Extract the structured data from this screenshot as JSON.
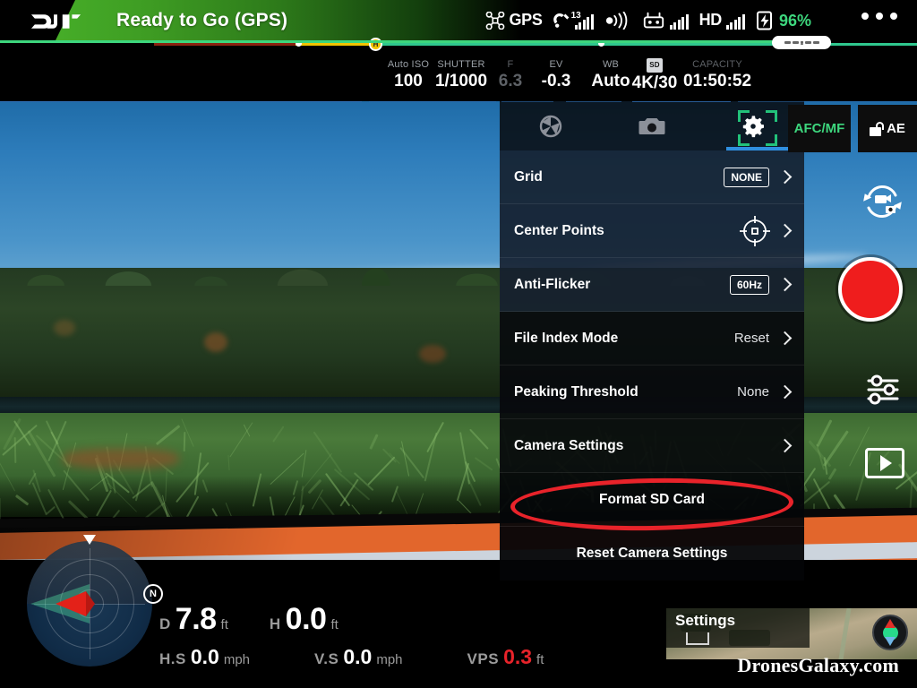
{
  "topbar": {
    "logo": "dji-logo",
    "status_title": "Ready to Go (GPS)",
    "gps_label": "GPS",
    "satellite_count": "13",
    "hd_label": "HD",
    "battery_percent": "96%",
    "icons": {
      "drone": "drone-icon",
      "satellite": "satellite-icon",
      "signal_bars": "signal-bars-icon",
      "transmission": "transmission-wave-icon",
      "remote": "remote-controller-icon",
      "battery": "battery-icon",
      "menu": "more-options-icon"
    },
    "colors": {
      "status_green": "#46ad28",
      "battery_green": "#3dd67d",
      "home_marker": "#f2c300"
    }
  },
  "parambar": {
    "items": [
      {
        "label": "Auto ISO",
        "value": "100",
        "name": "iso"
      },
      {
        "label": "SHUTTER",
        "value": "1/1000",
        "name": "shutter"
      },
      {
        "label": "F",
        "value": "6.3",
        "name": "aperture"
      },
      {
        "label": "EV",
        "value": "-0.3",
        "name": "ev"
      },
      {
        "label": "WB",
        "value": "Auto",
        "name": "white-balance"
      },
      {
        "label": "SD",
        "value": "4K/30",
        "name": "sd-resolution"
      },
      {
        "label": "CAPACITY",
        "value": "01:50:52",
        "name": "capacity"
      }
    ],
    "focus_mode": "AFC/MF",
    "ae_lock": "AE",
    "af_box": "af-target-box-icon"
  },
  "panel": {
    "tabs": [
      {
        "name": "aperture-tab",
        "icon": "aperture-icon",
        "active": false
      },
      {
        "name": "camera-tab",
        "icon": "camera-icon",
        "active": false
      },
      {
        "name": "settings-tab",
        "icon": "gear-icon",
        "active": true
      }
    ],
    "rows": [
      {
        "label": "Grid",
        "value": "NONE",
        "type": "chip",
        "name": "grid"
      },
      {
        "label": "Center Points",
        "value": "",
        "type": "target",
        "name": "center-points"
      },
      {
        "label": "Anti-Flicker",
        "value": "60Hz",
        "type": "chip",
        "name": "anti-flicker"
      },
      {
        "label": "File Index Mode",
        "value": "Reset",
        "type": "text",
        "name": "file-index-mode"
      },
      {
        "label": "Peaking Threshold",
        "value": "None",
        "type": "text",
        "name": "peaking-threshold"
      },
      {
        "label": "Camera Settings",
        "value": "",
        "type": "arrow",
        "name": "camera-settings"
      },
      {
        "label": "Format SD Card",
        "value": "",
        "type": "center",
        "name": "format-sd-card"
      },
      {
        "label": "Reset Camera Settings",
        "value": "",
        "type": "center",
        "name": "reset-camera-settings"
      }
    ],
    "highlight_color": "#e8232a",
    "active_tab_color": "#2f8fe0"
  },
  "right_controls": {
    "switch_mode": "switch-photo-video-icon",
    "shutter": "record-button",
    "exposure": "exposure-sliders-icon",
    "playback": "playback-icon",
    "record_color": "#ef1d1d"
  },
  "telemetry": {
    "distance": {
      "key": "D",
      "value": "7.8",
      "unit": "ft"
    },
    "height": {
      "key": "H",
      "value": "0.0",
      "unit": "ft"
    },
    "h_speed": {
      "key": "H.S",
      "value": "0.0",
      "unit": "mph"
    },
    "v_speed": {
      "key": "V.S",
      "value": "0.0",
      "unit": "mph"
    },
    "vps": {
      "key": "VPS",
      "value": "0.3",
      "unit": "ft"
    },
    "vps_color": "#e8232a"
  },
  "radar": {
    "north_label": "N",
    "name": "attitude-radar"
  },
  "minimap": {
    "ghost_label": "Settings",
    "compass": "map-compass-icon"
  },
  "watermark": "DronesGalaxy.com"
}
